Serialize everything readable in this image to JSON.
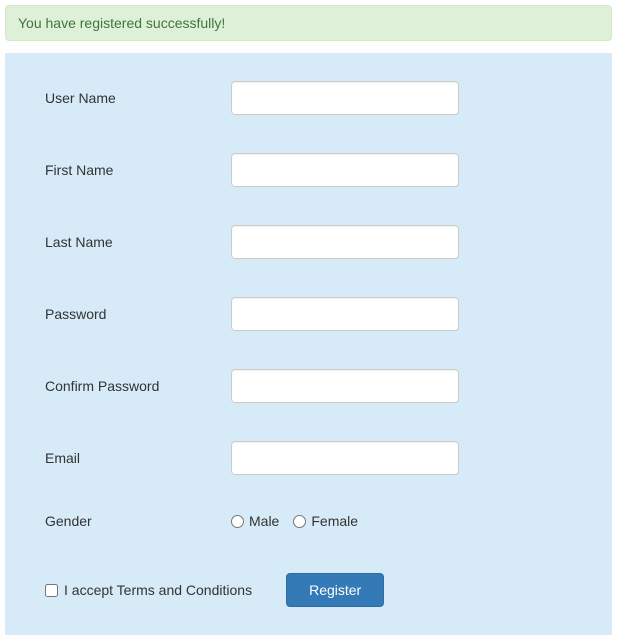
{
  "alert": {
    "message": "You have registered successfully!"
  },
  "form": {
    "fields": {
      "username": {
        "label": "User Name",
        "value": ""
      },
      "firstname": {
        "label": "First Name",
        "value": ""
      },
      "lastname": {
        "label": "Last Name",
        "value": ""
      },
      "password": {
        "label": "Password",
        "value": ""
      },
      "confirm_password": {
        "label": "Confirm Password",
        "value": ""
      },
      "email": {
        "label": "Email",
        "value": ""
      },
      "gender": {
        "label": "Gender",
        "options": {
          "male": "Male",
          "female": "Female"
        }
      }
    },
    "terms": {
      "label": "I accept Terms and Conditions",
      "checked": false
    },
    "submit_label": "Register"
  }
}
